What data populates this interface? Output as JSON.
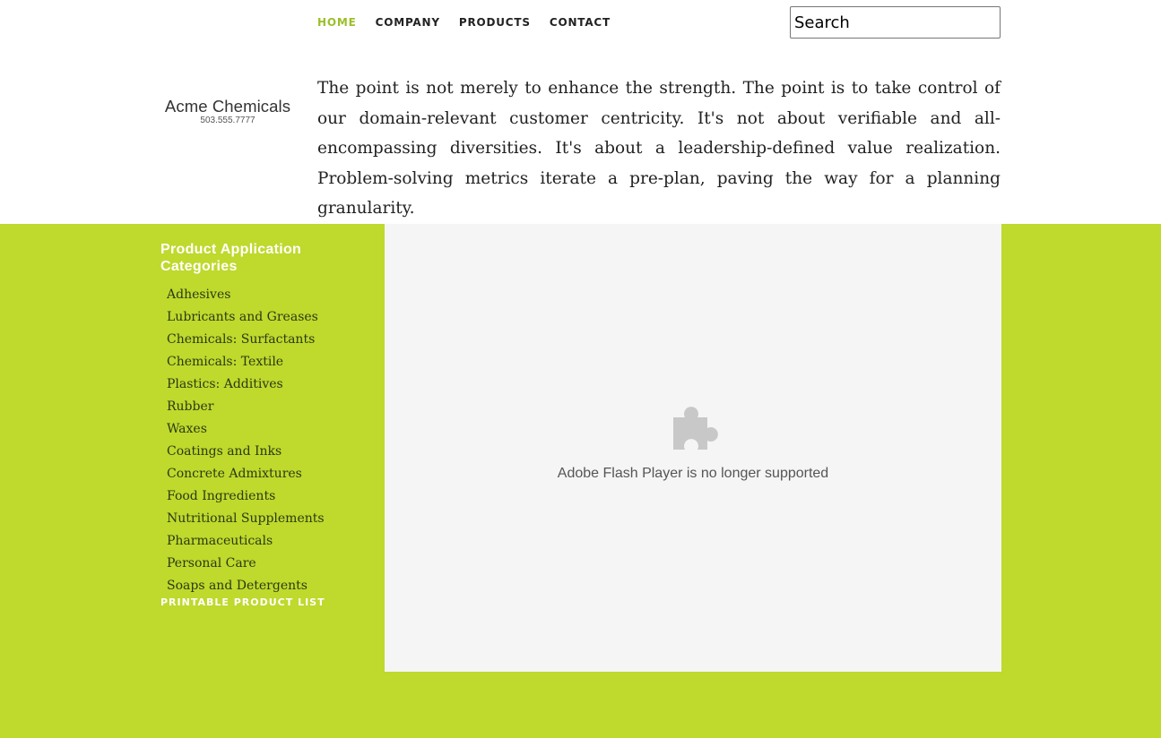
{
  "nav": {
    "items": [
      {
        "label": "HOME",
        "active": true
      },
      {
        "label": "COMPANY",
        "active": false
      },
      {
        "label": "PRODUCTS",
        "active": false
      },
      {
        "label": "CONTACT",
        "active": false
      }
    ],
    "active_color": "#9bbf2a"
  },
  "search": {
    "value": "",
    "placeholder": "Search"
  },
  "logo": {
    "name": "Acme Chemicals",
    "phone": "503.555.7777"
  },
  "intro": {
    "text": "The point is not merely to enhance the strength. The point is to take control of our domain-relevant customer centricity. It's not about verifiable and all-encompassing diversities. It's about a leadership-defined value realization. Problem-solving metrics iterate a pre-plan, paving the way for a planning granularity."
  },
  "sidebar": {
    "heading": "Product Application Categories",
    "items": [
      "Adhesives",
      "Lubricants and Greases",
      "Chemicals: Surfactants",
      "Chemicals: Textile",
      "Plastics: Additives",
      "Rubber",
      "Waxes",
      "Coatings and Inks",
      "Concrete Admixtures",
      "Food Ingredients",
      "Nutritional Supplements",
      "Pharmaceuticals",
      "Personal Care",
      "Soaps and Detergents"
    ],
    "printable_label": "PRINTABLE PRODUCT LIST"
  },
  "flash": {
    "icon": "puzzle-piece-icon",
    "message": "Adobe Flash Player is no longer supported"
  },
  "colors": {
    "accent_green": "#bfd92d",
    "flash_bg": "#f5f5f5"
  }
}
